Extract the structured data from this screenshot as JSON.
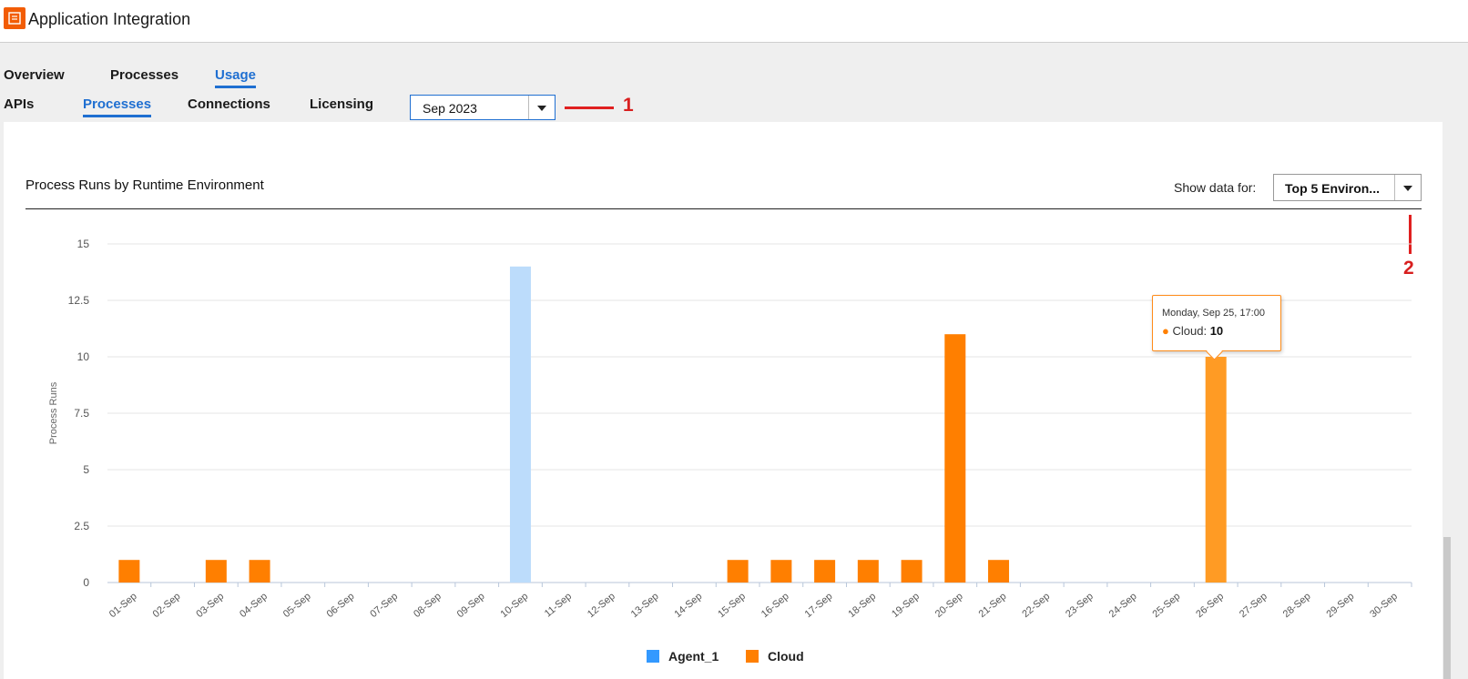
{
  "header": {
    "app_title": "Application Integration"
  },
  "tabs_primary": [
    {
      "label": "Overview",
      "active": false
    },
    {
      "label": "Processes",
      "active": false
    },
    {
      "label": "Usage",
      "active": true
    }
  ],
  "tabs_secondary": [
    {
      "label": "APIs",
      "active": false
    },
    {
      "label": "Processes",
      "active": true
    },
    {
      "label": "Connections",
      "active": false
    },
    {
      "label": "Licensing",
      "active": false
    }
  ],
  "month_select": {
    "value": "Sep 2023"
  },
  "annotations": {
    "one": "1",
    "two": "2"
  },
  "panel": {
    "show_label": "Show data for:",
    "env_select_value": "Top 5 Environ..."
  },
  "tooltip": {
    "date": "Monday, Sep 25, 17:00",
    "series": "Cloud",
    "value": "10"
  },
  "colors": {
    "agent": "#bcdcfb",
    "agent_legend": "#3399ff",
    "cloud": "#ff7f00",
    "cloud_highlight": "#ff9b24",
    "accent": "#1f6fd1",
    "annotation": "#e02020"
  },
  "chart_data": {
    "type": "bar",
    "title": "Process Runs by Runtime Environment",
    "ylabel": "Process Runs",
    "ylim": [
      0,
      15
    ],
    "yticks": [
      "0",
      "2.5",
      "5",
      "7.5",
      "10",
      "12.5",
      "15"
    ],
    "categories": [
      "01-Sep",
      "02-Sep",
      "03-Sep",
      "04-Sep",
      "05-Sep",
      "06-Sep",
      "07-Sep",
      "08-Sep",
      "09-Sep",
      "10-Sep",
      "11-Sep",
      "12-Sep",
      "13-Sep",
      "14-Sep",
      "15-Sep",
      "16-Sep",
      "17-Sep",
      "18-Sep",
      "19-Sep",
      "20-Sep",
      "21-Sep",
      "22-Sep",
      "23-Sep",
      "24-Sep",
      "25-Sep",
      "26-Sep",
      "27-Sep",
      "28-Sep",
      "29-Sep",
      "30-Sep"
    ],
    "series": [
      {
        "name": "Agent_1",
        "values": [
          0,
          0,
          0,
          0,
          0,
          0,
          0,
          0,
          0,
          14,
          0,
          0,
          0,
          0,
          0,
          0,
          0,
          0,
          0,
          0,
          0,
          0,
          0,
          0,
          0,
          0,
          0,
          0,
          0,
          0
        ]
      },
      {
        "name": "Cloud",
        "values": [
          1,
          0,
          1,
          1,
          0,
          0,
          0,
          0,
          0,
          0,
          0,
          0,
          0,
          0,
          1,
          1,
          1,
          1,
          1,
          11,
          1,
          0,
          0,
          0,
          0,
          10,
          0,
          0,
          0,
          0
        ]
      }
    ],
    "grid": true,
    "legend": "bottom-center"
  }
}
